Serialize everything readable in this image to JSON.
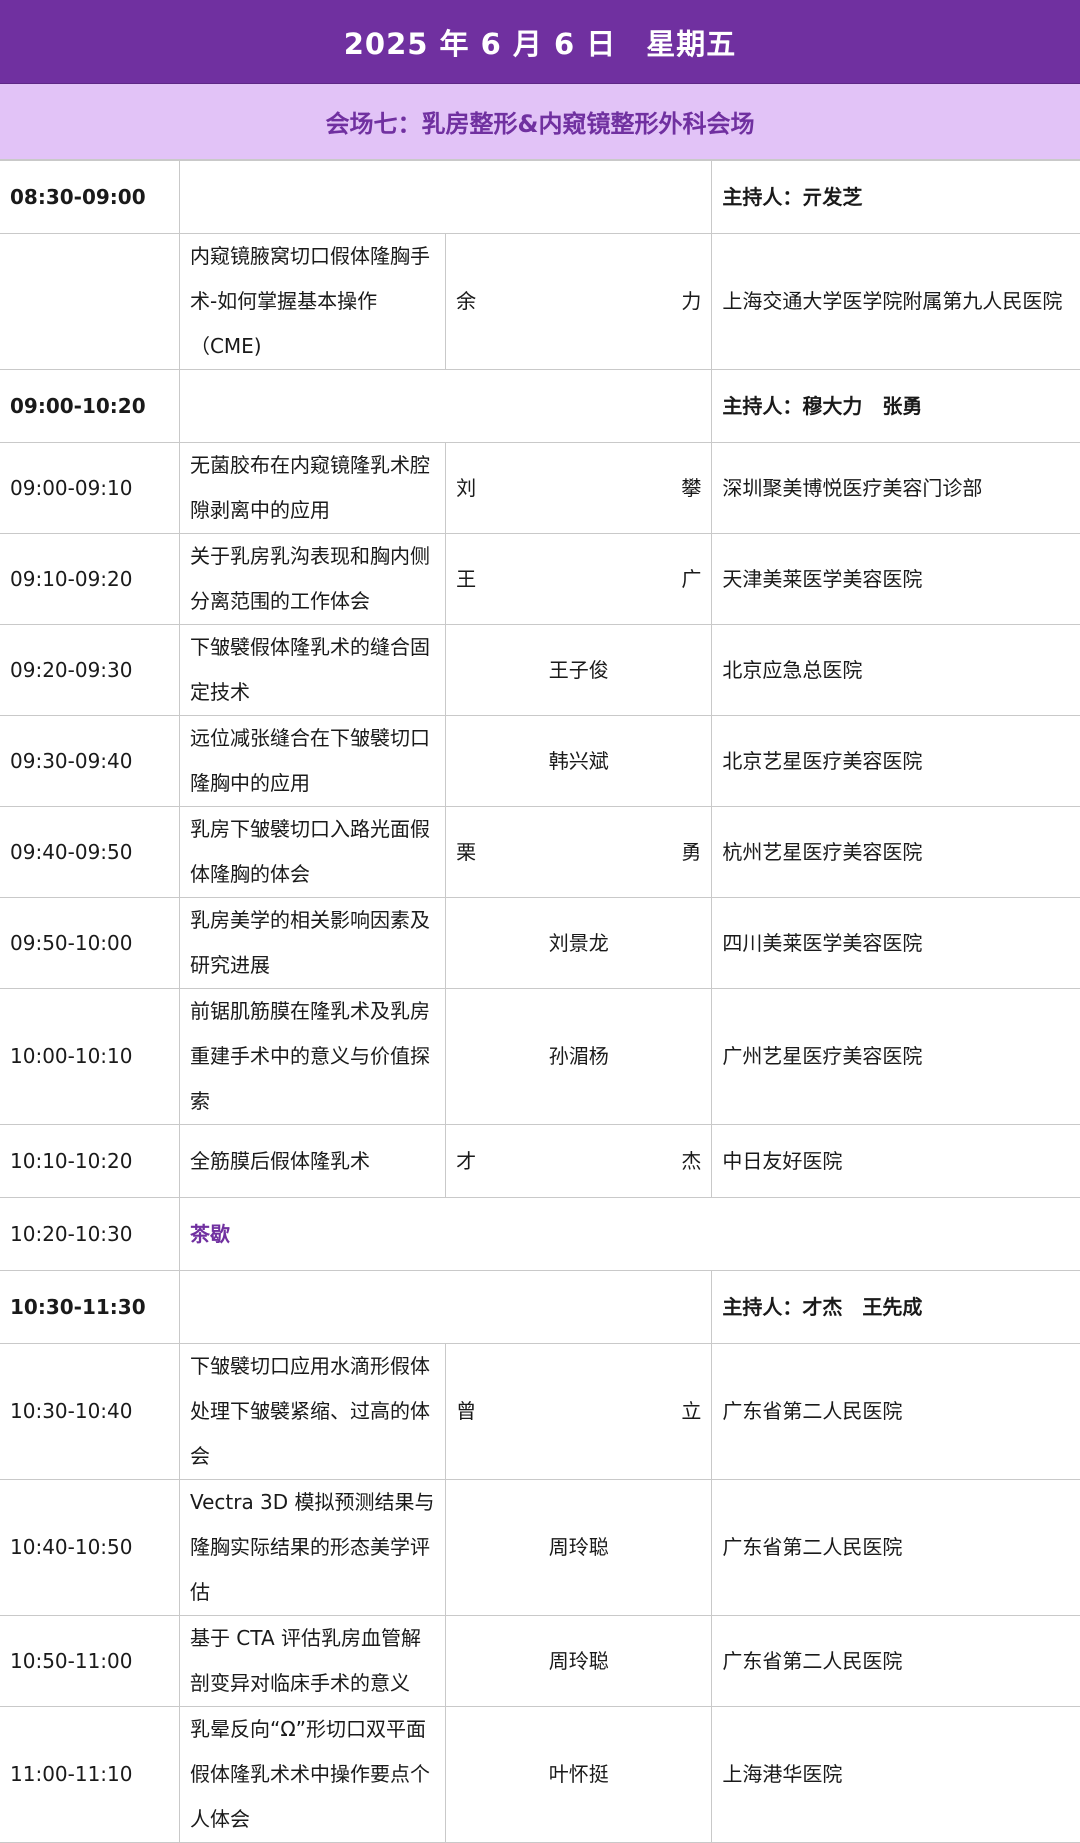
{
  "header": {
    "date": "2025 年 6 月 6 日　星期五",
    "venue": "会场七：乳房整形&内窥镜整形外科会场"
  },
  "sessions": [
    {
      "time": "08:30-09:00",
      "host": "主持人：亓发芝",
      "rows": [
        {
          "time": "",
          "topic": "内窥镜腋窝切口假体隆胸手术-如何掌握基本操作（CME)",
          "speaker": "余力",
          "institution": "上海交通大学医学院附属第九人民医院"
        }
      ]
    },
    {
      "time": "09:00-10:20",
      "host": "主持人：穆大力　张勇",
      "rows": [
        {
          "time": "09:00-09:10",
          "topic": "无菌胶布在内窥镜隆乳术腔隙剥离中的应用",
          "speaker": "刘攀",
          "institution": "深圳聚美博悦医疗美容门诊部"
        },
        {
          "time": "09:10-09:20",
          "topic": "关于乳房乳沟表现和胸内侧分离范围的工作体会",
          "speaker": "王广",
          "institution": "天津美莱医学美容医院"
        },
        {
          "time": "09:20-09:30",
          "topic": "下皱襞假体隆乳术的缝合固定技术",
          "speaker": "王子俊",
          "institution": "北京应急总医院"
        },
        {
          "time": "09:30-09:40",
          "topic": "远位减张缝合在下皱襞切口隆胸中的应用",
          "speaker": "韩兴斌",
          "institution": "北京艺星医疗美容医院"
        },
        {
          "time": "09:40-09:50",
          "topic": "乳房下皱襞切口入路光面假体隆胸的体会",
          "speaker": "栗勇",
          "institution": "杭州艺星医疗美容医院"
        },
        {
          "time": "09:50-10:00",
          "topic": "乳房美学的相关影响因素及研究进展",
          "speaker": "刘景龙",
          "institution": "四川美莱医学美容医院"
        },
        {
          "time": "10:00-10:10",
          "topic": "前锯肌筋膜在隆乳术及乳房重建手术中的意义与价值探索",
          "speaker": "孙湄杨",
          "institution": "广州艺星医疗美容医院"
        },
        {
          "time": "10:10-10:20",
          "topic": "全筋膜后假体隆乳术",
          "speaker": "才杰",
          "institution": "中日友好医院"
        }
      ]
    },
    {
      "break_time": "10:20-10:30",
      "break_label": "茶歇"
    },
    {
      "time": "10:30-11:30",
      "host": "主持人：才杰　王先成",
      "rows": [
        {
          "time": "10:30-10:40",
          "topic": "下皱襞切口应用水滴形假体处理下皱襞紧缩、过高的体会",
          "speaker": "曾立",
          "institution": "广东省第二人民医院"
        },
        {
          "time": "10:40-10:50",
          "topic": "Vectra 3D 模拟预测结果与隆胸实际结果的形态美学评估",
          "speaker": "周玲聪",
          "institution": "广东省第二人民医院"
        },
        {
          "time": "10:50-11:00",
          "topic": "基于 CTA 评估乳房血管解剖变异对临床手术的意义",
          "speaker": "周玲聪",
          "institution": "广东省第二人民医院"
        },
        {
          "time": "11:00-11:10",
          "topic": "乳晕反向“Ω”形切口双平面假体隆乳术术中操作要点个人体会",
          "speaker": "叶怀挺",
          "institution": "上海港华医院"
        }
      ]
    }
  ]
}
